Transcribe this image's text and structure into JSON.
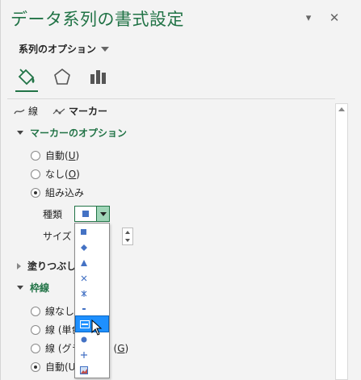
{
  "pane": {
    "title": "データ系列の書式設定",
    "series_options": "系列のオプション"
  },
  "tabs": [
    {
      "label": "線"
    },
    {
      "label": "マーカー"
    }
  ],
  "sections": {
    "marker_options": "マーカーのオプション",
    "fill": "塗りつぶし",
    "border": "枠線"
  },
  "marker_radios": [
    {
      "label": "自動(",
      "key": "U",
      "tail": ")",
      "checked": false
    },
    {
      "label": "なし(",
      "key": "O",
      "tail": ")",
      "checked": false
    },
    {
      "label": "組み込み",
      "key": "",
      "tail": "",
      "checked": true
    }
  ],
  "fields": {
    "type_label": "種類",
    "size_label": "サイズ"
  },
  "border_radios": [
    {
      "label": "線なし(",
      "checked": false
    },
    {
      "label": "線 (単色",
      "checked": false
    },
    {
      "label": "線 (グラ",
      "tail2": "(",
      "key": "G",
      "tail": ")",
      "checked": false
    },
    {
      "label": "自動(U",
      "checked": true
    }
  ],
  "dropdown": {
    "selected": "square",
    "items": [
      "square",
      "diamond",
      "triangle",
      "x",
      "star",
      "short-dash",
      "long-dash",
      "circle",
      "plus",
      "picture"
    ],
    "hover_index": 6
  },
  "colors": {
    "accent": "#217346",
    "hover": "#1e90ff",
    "marker_blue": "#4472c4"
  }
}
